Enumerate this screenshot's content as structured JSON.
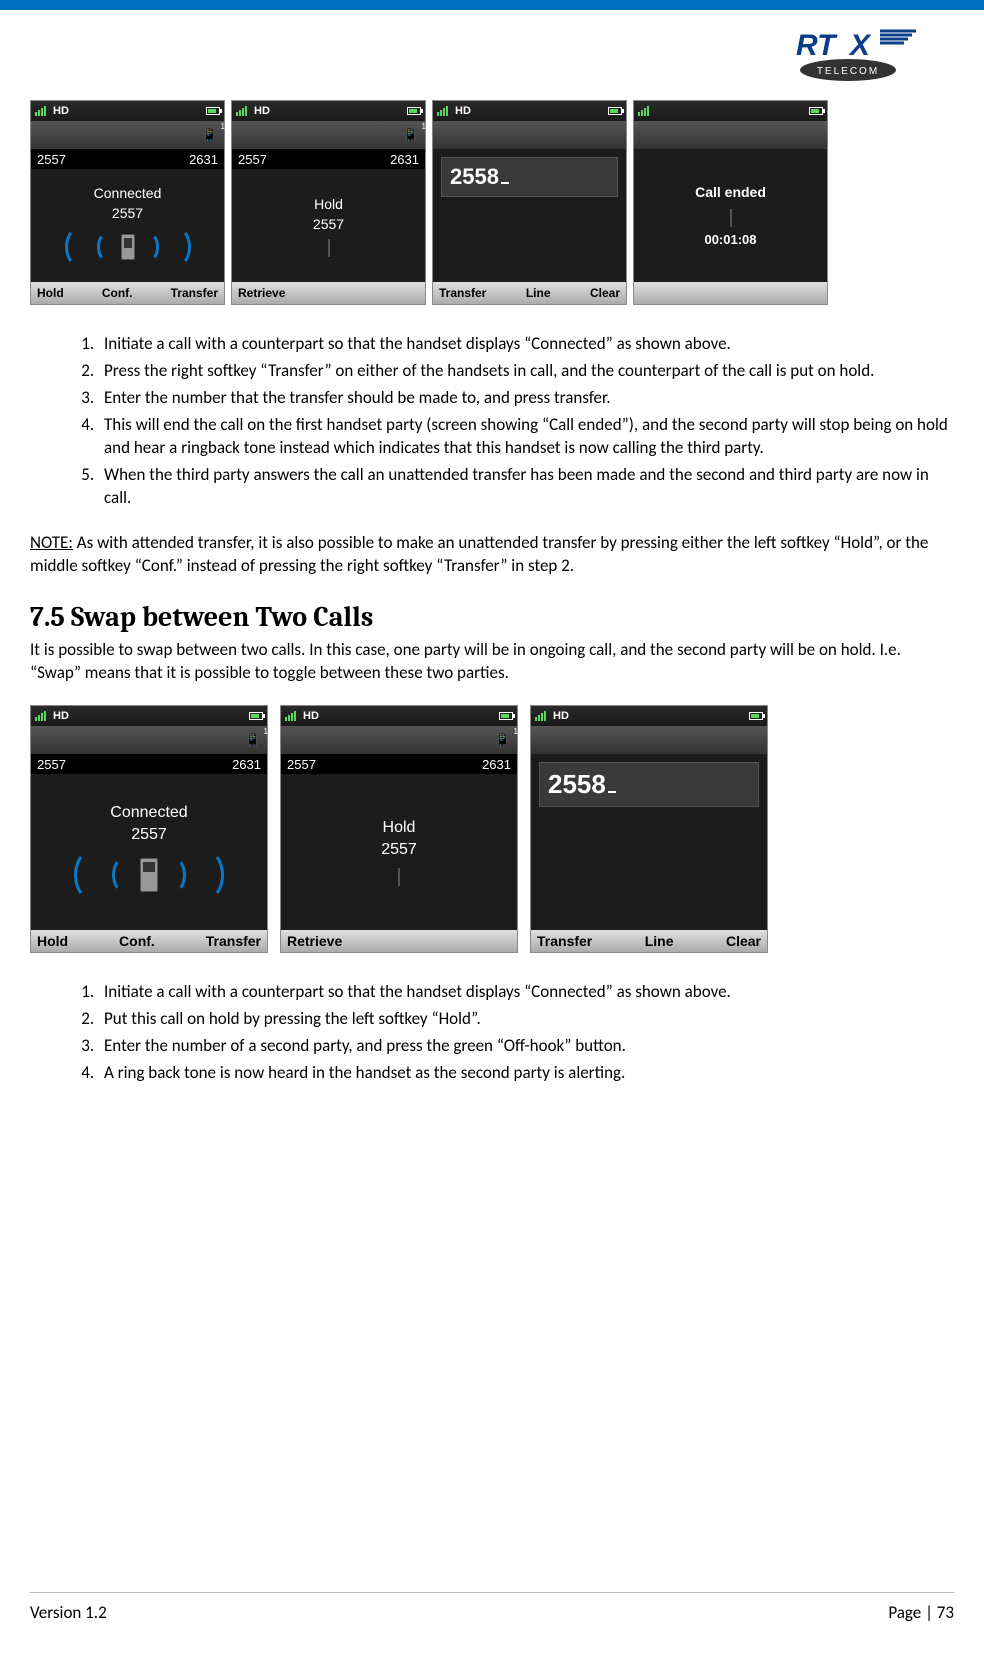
{
  "logo_alt": "RTX Telecom",
  "row1_screen1": {
    "hd": "HD",
    "numL": "2557",
    "numR": "2631",
    "status": "Connected",
    "statusNum": "2557",
    "soft1": "Hold",
    "soft2": "Conf.",
    "soft3": "Transfer"
  },
  "row1_screen2": {
    "hd": "HD",
    "numL": "2557",
    "numR": "2631",
    "status": "Hold",
    "statusNum": "2557",
    "soft1": "Retrieve"
  },
  "row1_screen3": {
    "hd": "HD",
    "dial": "2558",
    "soft1": "Transfer",
    "soft2": "Line",
    "soft3": "Clear"
  },
  "row1_screen4": {
    "status": "Call ended",
    "duration": "00:01:08"
  },
  "steps1": {
    "i1": "Initiate a call with a counterpart so that the handset displays “Connected” as shown above.",
    "i2": "Press the right softkey “Transfer” on either of the handsets in call, and the counterpart of the call is put on hold.",
    "i3": "Enter the number that the transfer should be made to, and press transfer.",
    "i4": "This will end the call on the first handset party (screen showing “Call ended”), and the second party will stop being on hold and hear a ringback tone instead which indicates that this handset is now calling the third party.",
    "i5": "When the third party answers the call an unattended transfer has been made and the second and third party are now in call."
  },
  "note_label": "NOTE:",
  "note_text": " As with attended transfer, it is also possible to make an unattended transfer by pressing either the left softkey “Hold”, or the middle softkey “Conf.” instead of pressing the right softkey “Transfer” in step 2.",
  "section_heading": "7.5 Swap between Two Calls",
  "section_para": "It is possible to swap between two calls. In this case, one party will be in ongoing call, and the second party will be on hold. I.e. “Swap” means that it is possible to toggle between these two parties.",
  "row2_screen1": {
    "hd": "HD",
    "numL": "2557",
    "numR": "2631",
    "status": "Connected",
    "statusNum": "2557",
    "soft1": "Hold",
    "soft2": "Conf.",
    "soft3": "Transfer"
  },
  "row2_screen2": {
    "hd": "HD",
    "numL": "2557",
    "numR": "2631",
    "status": "Hold",
    "statusNum": "2557",
    "soft1": "Retrieve"
  },
  "row2_screen3": {
    "hd": "HD",
    "dial": "2558",
    "soft1": "Transfer",
    "soft2": "Line",
    "soft3": "Clear"
  },
  "steps2": {
    "i1": "Initiate a call with a counterpart so that the handset displays “Connected” as shown above.",
    "i2": "Put this call on hold by pressing the left softkey “Hold”.",
    "i3": "Enter the number of a second party, and press the green “Off-hook” button.",
    "i4": "A ring back tone is now heard in the handset as the second party is alerting."
  },
  "footer_version": "Version 1.2",
  "footer_page": "Page | 73"
}
